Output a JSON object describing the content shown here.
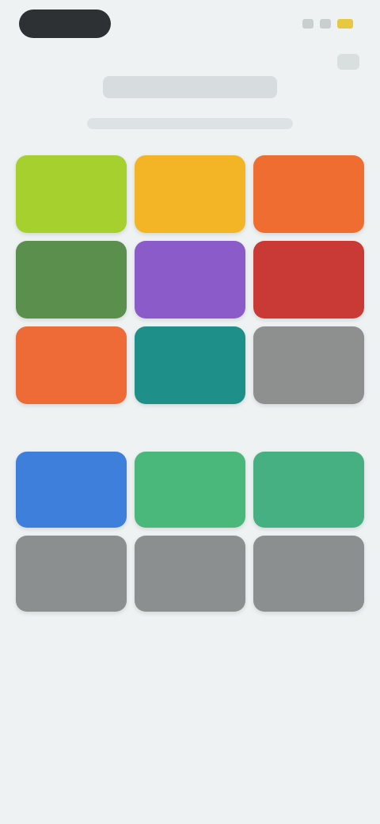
{
  "status_bar": {
    "time": ""
  },
  "header": {
    "title": "",
    "subtitle": ""
  },
  "grid_one": {
    "tiles": [
      {
        "label": "",
        "color": "#a6d02e"
      },
      {
        "label": "",
        "color": "#f3b525"
      },
      {
        "label": "",
        "color": "#ef6d30"
      },
      {
        "label": "",
        "color": "#5b8f4e"
      },
      {
        "label": "",
        "color": "#8b5bc9"
      },
      {
        "label": "",
        "color": "#c93a36"
      },
      {
        "label": "",
        "color": "#ee6a37"
      },
      {
        "label": "",
        "color": "#1f8f8a"
      },
      {
        "label": "",
        "color": "#8e9090"
      }
    ]
  },
  "grid_two": {
    "tiles": [
      {
        "label": "",
        "color": "#3f7fdc"
      },
      {
        "label": "",
        "color": "#49b87a"
      },
      {
        "label": "",
        "color": "#46b083"
      },
      {
        "label": "",
        "color": "#8c8f90"
      },
      {
        "label": "",
        "color": "#8c8f90"
      },
      {
        "label": "",
        "color": "#8c8f90"
      }
    ]
  }
}
